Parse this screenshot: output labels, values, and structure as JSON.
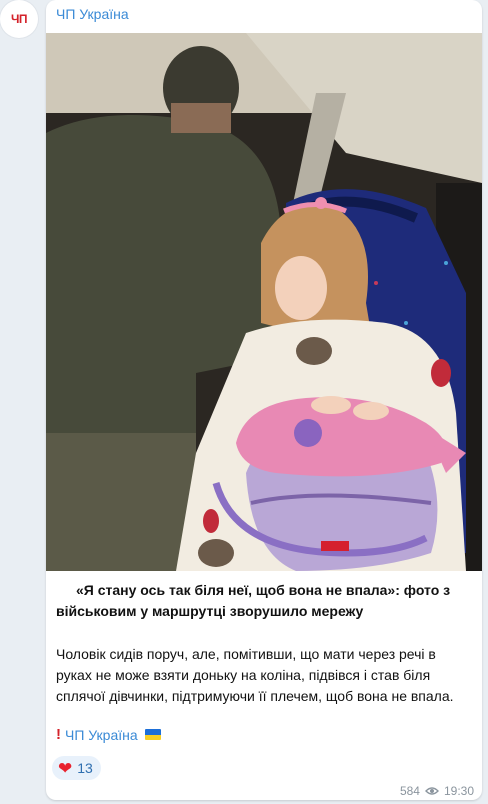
{
  "channel": {
    "name": "ЧП Україна",
    "avatar_text": "ЧП"
  },
  "post": {
    "headline": "«Я стану ось так біля неї, щоб вона не впала»: фото з військовим у маршрутці зворушило мережу",
    "body": "Чоловік сидів поруч, але, помітивши, що мати через речі в руках не може взяти доньку на коліна, підвівся і став біля сплячої дівчинки, підтримуючи її плечем, щоб вона не впала.",
    "signature": "ЧП Україна",
    "reaction": {
      "icon": "heart-icon",
      "count": "13"
    },
    "views": "584",
    "time": "19:30"
  },
  "colors": {
    "accent": "#3a8ad6",
    "background": "#e9eef3",
    "flag_blue": "#1d6fd8",
    "flag_yellow": "#f7cf24"
  }
}
